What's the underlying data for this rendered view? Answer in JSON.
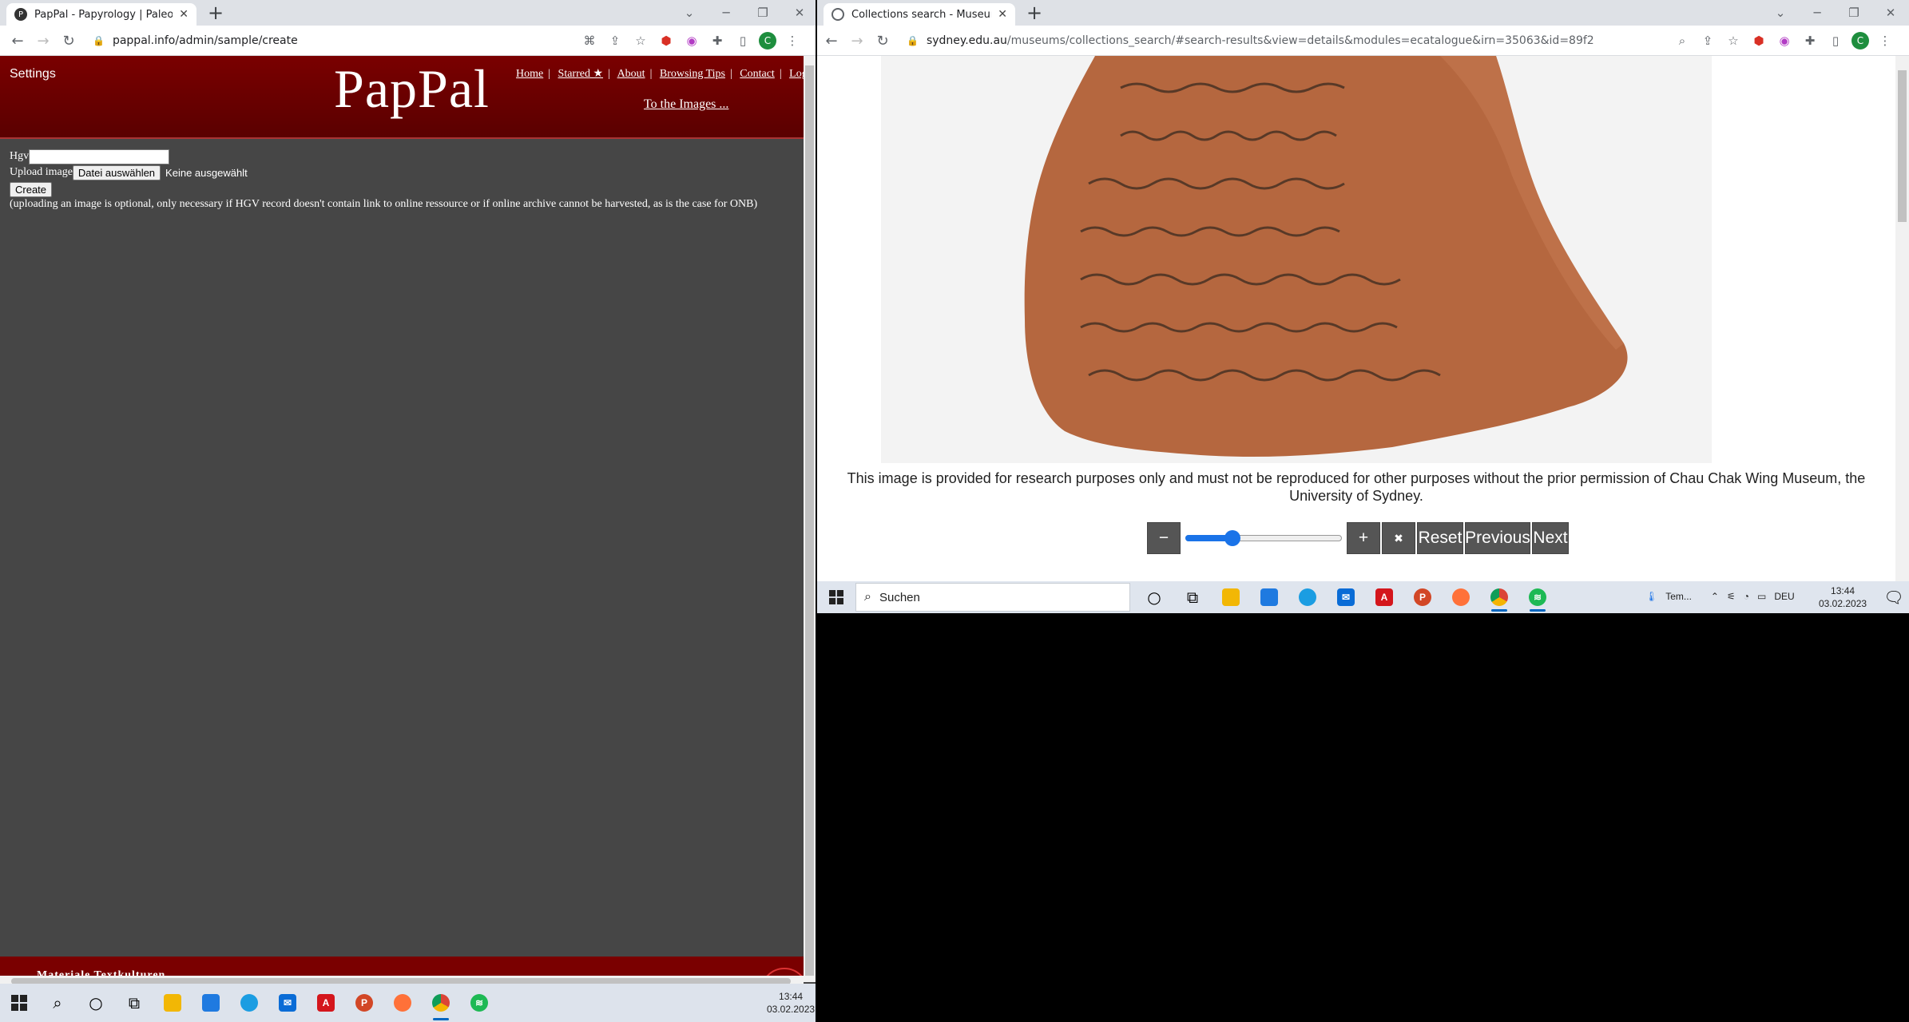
{
  "left_browser": {
    "tab_title": "PapPal - Papyrology | Paleograph",
    "url": "pappal.info/admin/sample/create",
    "avatar_letter": "C"
  },
  "pappal": {
    "settings_label": "Settings",
    "logo_text": "PapPal",
    "nav": [
      "Home",
      "Starred ★",
      "About",
      "Browsing Tips",
      "Contact",
      "Logou"
    ],
    "to_images_label": "To the Images ...",
    "hgv_label": "Hgv",
    "upload_label": "Upload image",
    "file_button_label": "Datei auswählen",
    "no_file_label": "Keine ausgewählt",
    "create_button_label": "Create",
    "note": "(uploading an image is optional, only necessary if HGV record doesn't contain link to online ressource or if online archive cannot be harvested, as is the case for ONB)",
    "footer_text": "Materiale Textkulturen"
  },
  "right_browser": {
    "tab_title": "Collections search - Museums - T",
    "url_host": "sydney.edu.au",
    "url_rest": "/museums/collections_search/#search-results&view=details&modules=ecatalogue&irn=35063&id=89f2",
    "avatar_letter": "C"
  },
  "museum": {
    "caption": "This image is provided for research purposes only and must not be reproduced for other purposes without the prior permission of Chau Chak Wing Museum, the University of Sydney.",
    "zoom_out_label": "−",
    "zoom_in_label": "+",
    "fullscreen_label": "✖",
    "reset_label": "Reset",
    "previous_label": "Previous",
    "next_label": "Next",
    "zoom_level": 0.28
  },
  "taskbar_left": {
    "time": "13:44",
    "date": "03.02.2023"
  },
  "taskbar_right": {
    "search_placeholder": "Suchen",
    "weather": "Tem...",
    "lang": "DEU",
    "time": "13:44",
    "date": "03.02.2023"
  },
  "colors": {
    "pappal_red": "#7a0000",
    "page_gray": "#464646",
    "slider_blue": "#1a73e8"
  }
}
